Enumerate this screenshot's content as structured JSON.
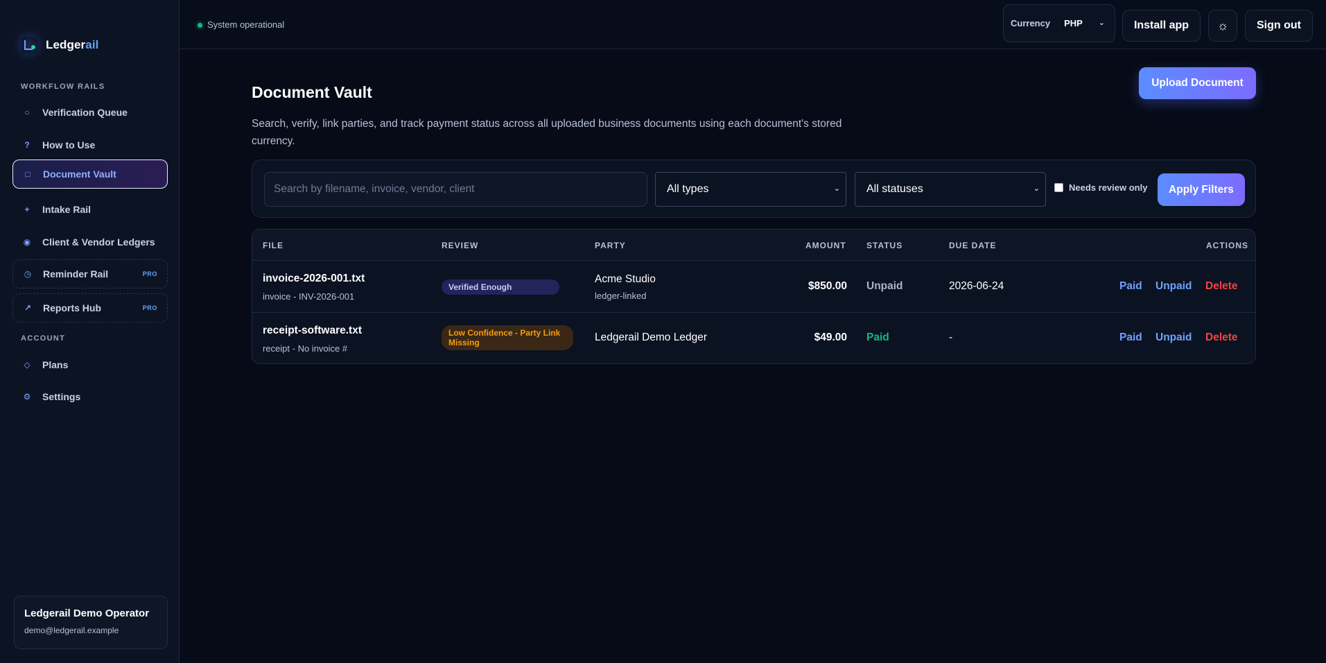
{
  "brand": {
    "name_main": "Ledger",
    "name_accent": "ail"
  },
  "sidebar": {
    "section_workflow": "WORKFLOW RAILS",
    "section_account": "ACCOUNT",
    "items": [
      {
        "label": "Verification Queue",
        "icon": "circle-icon"
      },
      {
        "label": "How to Use",
        "icon": "question-icon"
      },
      {
        "label": "Document Vault",
        "icon": "square-icon"
      },
      {
        "label": "Intake Rail",
        "icon": "plus-icon"
      },
      {
        "label": "Client & Vendor Ledgers",
        "icon": "target-icon"
      },
      {
        "label": "Reminder Rail",
        "icon": "clock-icon",
        "badge": "PRO"
      },
      {
        "label": "Reports Hub",
        "icon": "arrow-up-right-icon",
        "badge": "PRO"
      },
      {
        "label": "Plans",
        "icon": "diamond-icon"
      },
      {
        "label": "Settings",
        "icon": "gear-icon"
      }
    ],
    "user": {
      "name": "Ledgerail Demo Operator",
      "email": "demo@ledgerail.example"
    }
  },
  "topbar": {
    "status": "System operational",
    "currency_label": "Currency",
    "currency_value": "PHP",
    "install_label": "Install app",
    "theme_icon": "sun-icon",
    "signout_label": "Sign out"
  },
  "main": {
    "title": "Document Vault",
    "description": "Search, verify, link parties, and track payment status across all uploaded business documents using each document's stored currency.",
    "upload_label": "Upload Document",
    "filters": {
      "search_placeholder": "Search by filename, invoice, vendor, client",
      "type_value": "All types",
      "status_value": "All statuses",
      "needs_review_label": "Needs review only",
      "apply_label": "Apply Filters"
    },
    "table": {
      "headers": [
        "FILE",
        "REVIEW",
        "PARTY",
        "AMOUNT",
        "STATUS",
        "DUE DATE",
        "ACTIONS"
      ],
      "rows": [
        {
          "file": "invoice-2026-001.txt",
          "file_sub": "invoice - INV-2026-001",
          "review": "Verified Enough",
          "party": "Acme Studio",
          "party_sub": "ledger-linked",
          "amount": "$850.00",
          "status": "Unpaid",
          "due": "2026-06-24",
          "actions": [
            "Paid",
            "Unpaid",
            "Delete"
          ]
        },
        {
          "file": "receipt-software.txt",
          "file_sub": "receipt - No invoice #",
          "review": "Low Confidence - Party Link Missing",
          "party": "Ledgerail Demo Ledger",
          "party_sub": "",
          "amount": "$49.00",
          "status": "Paid",
          "due": "-",
          "actions": [
            "Paid",
            "Unpaid",
            "Delete"
          ]
        }
      ]
    }
  },
  "colors": {
    "accent": "#5b8cff",
    "paid": "#10b981",
    "delete": "#ef4444",
    "warning": "#f59e0b"
  }
}
